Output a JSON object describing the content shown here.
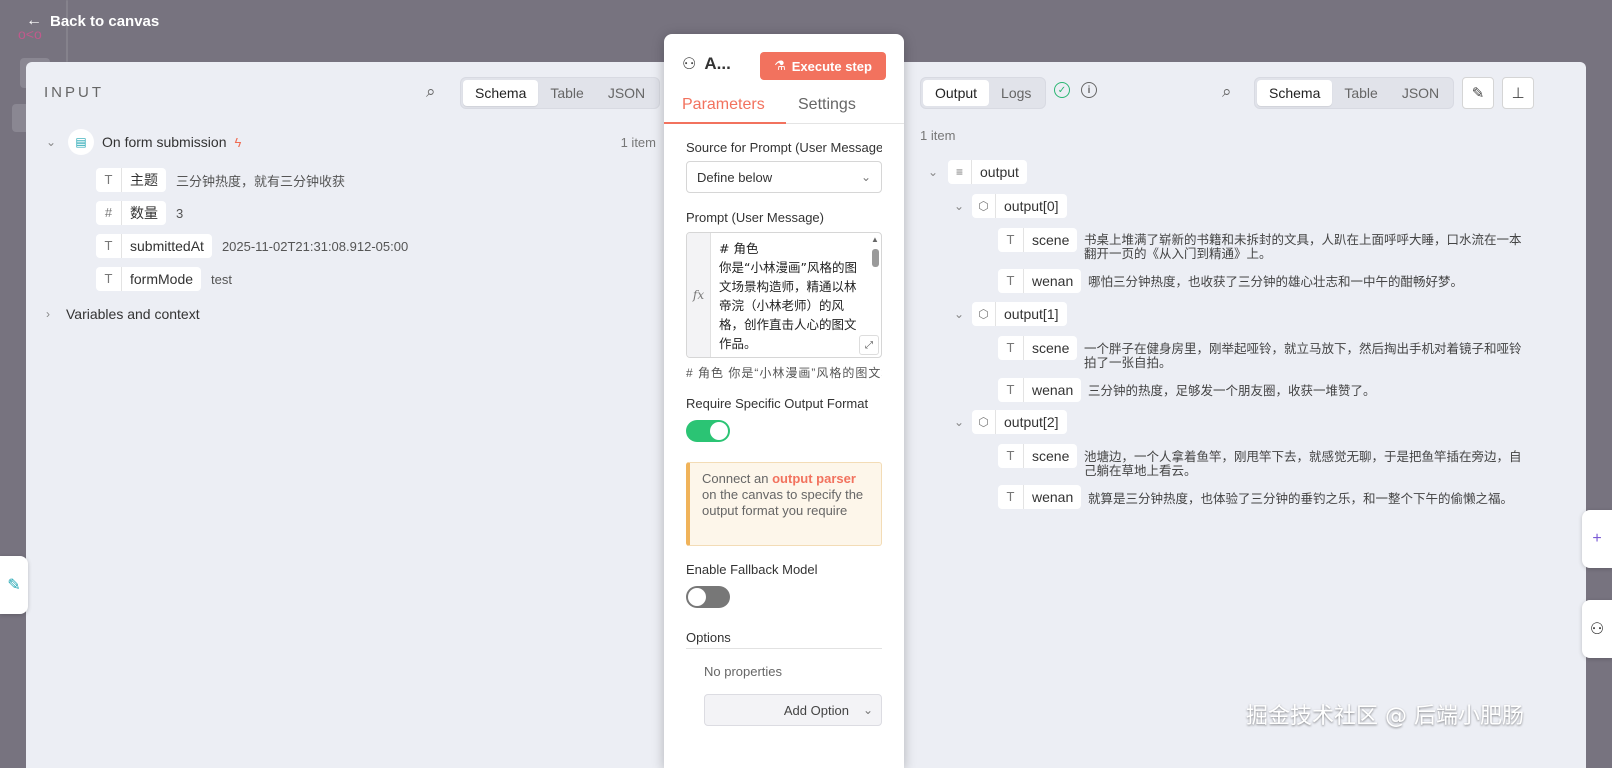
{
  "header": {
    "back_label": "Back to canvas"
  },
  "input": {
    "title": "INPUT",
    "view_tabs": [
      "Schema",
      "Table",
      "JSON"
    ],
    "node": {
      "name": "On form submission",
      "count": "1 item"
    },
    "fields": [
      {
        "type_glyph": "T",
        "key": "主题",
        "value": "三分钟热度，就有三分钟收获"
      },
      {
        "type_glyph": "#",
        "key": "数量",
        "value": "3"
      },
      {
        "type_glyph": "T",
        "key": "submittedAt",
        "value": "2025-11-02T21:31:08.912-05:00"
      },
      {
        "type_glyph": "T",
        "key": "formMode",
        "value": "test"
      }
    ],
    "variables_label": "Variables and context"
  },
  "center": {
    "node_title": "A...",
    "execute_label": "Execute step",
    "tabs": [
      "Parameters",
      "Settings"
    ],
    "source_label": "Source for Prompt (User Message)",
    "source_value": "Define below",
    "prompt_label": "Prompt (User Message)",
    "prompt_text": "# 角色\n你是“小林漫画”风格的图文场景构造师，精通以林帝浣（小林老师）的风格，创作直击人心的图文作品。",
    "prompt_preview": "# 角色 你是“小林漫画”风格的图文场景构造师",
    "require_format_label": "Require Specific Output Format",
    "require_format_on": true,
    "notice_pre": "Connect an ",
    "notice_link": "output parser",
    "notice_post": " on the canvas to specify the output format you require",
    "fallback_label": "Enable Fallback Model",
    "fallback_on": false,
    "options_label": "Options",
    "no_properties": "No properties",
    "add_option_label": "Add Option"
  },
  "output": {
    "tabs": [
      "Output",
      "Logs"
    ],
    "view_tabs": [
      "Schema",
      "Table",
      "JSON"
    ],
    "count": "1 item",
    "root_key": "output",
    "items": [
      {
        "key": "output[0]",
        "scene": "书桌上堆满了崭新的书籍和未拆封的文具，人趴在上面呼呼大睡，口水流在一本翻开一页的《从入门到精通》上。",
        "wenan": "哪怕三分钟热度，也收获了三分钟的雄心壮志和一中午的酣畅好梦。"
      },
      {
        "key": "output[1]",
        "scene": "一个胖子在健身房里，刚举起哑铃，就立马放下，然后掏出手机对着镜子和哑铃拍了一张自拍。",
        "wenan": "三分钟的热度，足够发一个朋友圈，收获一堆赞了。"
      },
      {
        "key": "output[2]",
        "scene": "池塘边，一个人拿着鱼竿，刚甩竿下去，就感觉无聊，于是把鱼竿插在旁边，自己躺在草地上看云。",
        "wenan": "就算是三分钟热度，也体验了三分钟的垂钓之乐，和一整个下午的偷懒之福。"
      }
    ],
    "field_scene": "scene",
    "field_wenan": "wenan"
  },
  "watermark": "掘金技术社区 @ 后端小肥肠",
  "colors": {
    "accent": "#f2725e",
    "success": "#2bb673",
    "toggle_on": "#2bc474",
    "toggle_off": "#777777"
  }
}
